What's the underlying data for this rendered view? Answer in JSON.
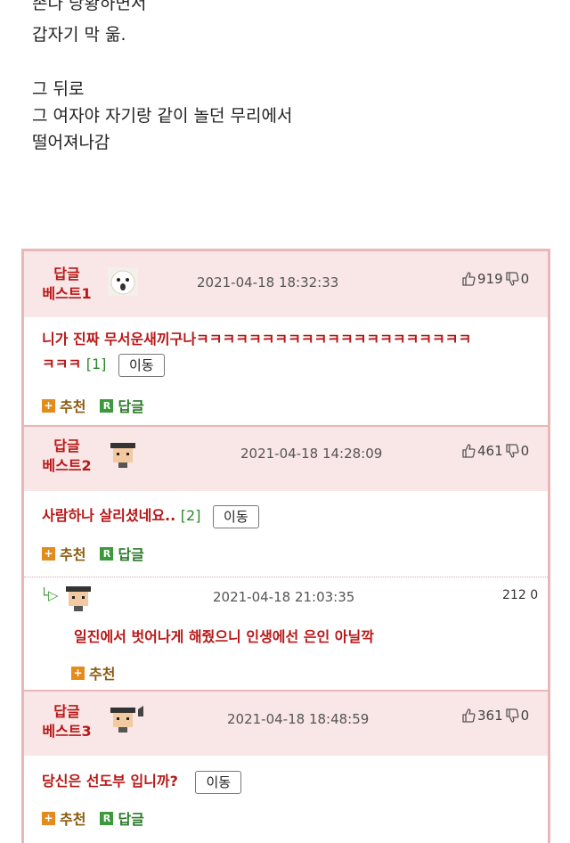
{
  "story": {
    "lines": [
      "존나 당황하면서",
      "갑자기 막 욺.",
      "그 뒤로",
      "그 여자야 자기랑 같이 놀던 무리에서",
      "떨어져나감"
    ]
  },
  "comments": [
    {
      "badge_top": "답글",
      "badge_bottom": "베스트1",
      "avatar_icon": "dog-avatar-icon",
      "date": "2021-04-18 18:32:33",
      "up": "919",
      "down": "0",
      "text_line1": "니가 진짜 무서운새끼구나ㅋㅋㅋㅋㅋㅋㅋㅋㅋㅋㅋㅋㅋㅋㅋㅋㅋㅋㅋㅋㅋ",
      "text_line2": "ㅋㅋㅋ",
      "ref": "[1]",
      "move_label": "이동",
      "recommend_label": "추천",
      "reply_label": "답글"
    },
    {
      "badge_top": "답글",
      "badge_bottom": "베스트2",
      "avatar_icon": "pixel-person-avatar-icon",
      "date": "2021-04-18 14:28:09",
      "up": "461",
      "down": "0",
      "text_line1": "사람하나 살리셨네요..",
      "ref": "[2]",
      "move_label": "이동",
      "recommend_label": "추천",
      "reply_label": "답글",
      "reply": {
        "arrow": "└▷",
        "date": "2021-04-18 21:03:35",
        "up": "212",
        "down": "0",
        "text": "일진에서 벗어나게 해줬으니 인생에선 은인 아닐깍",
        "recommend_label": "추천"
      }
    },
    {
      "badge_top": "답글",
      "badge_bottom": "베스트3",
      "avatar_icon": "pixel-person-avatar-icon",
      "date": "2021-04-18 18:48:59",
      "up": "361",
      "down": "0",
      "text_line1": "당신은 선도부 입니까?",
      "move_label": "이동",
      "recommend_label": "추천",
      "reply_label": "답글"
    }
  ],
  "colors": {
    "accent_red": "#b81717",
    "border_pink": "#e9b7b7",
    "header_pink": "#f9e6e6",
    "recommend_orange": "#e38b1c",
    "reply_green": "#3c9a3c"
  }
}
